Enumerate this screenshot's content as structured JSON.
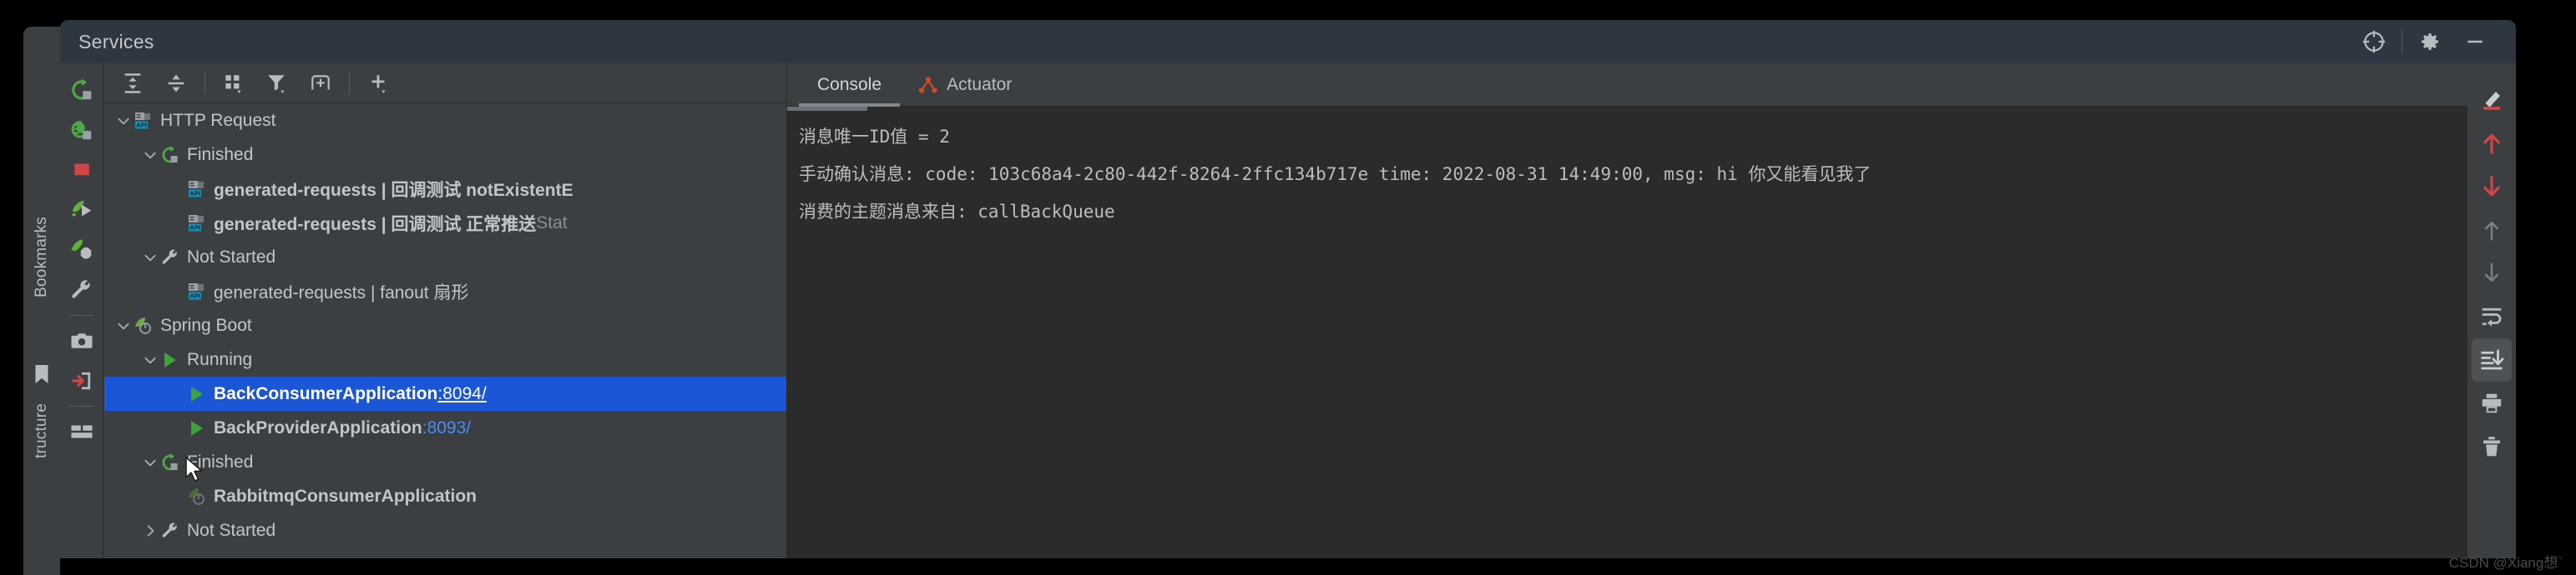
{
  "window": {
    "title": "Services"
  },
  "titlebar_actions": [
    {
      "name": "locate-icon",
      "label": "Select Opened File"
    },
    {
      "name": "gear-icon",
      "label": "Settings"
    },
    {
      "name": "minimize-icon",
      "label": "Hide"
    }
  ],
  "left_strip": {
    "bookmarks_label": "Bookmarks",
    "structure_label": "tructure"
  },
  "rail_actions": [
    {
      "name": "rerun-icon",
      "label": "Rerun"
    },
    {
      "name": "rerun-debug-icon",
      "label": "Rerun Debug"
    },
    {
      "name": "stop-icon",
      "label": "Stop"
    },
    {
      "name": "run-icon",
      "label": "Run"
    },
    {
      "name": "debug-icon",
      "label": "Debug"
    },
    {
      "name": "wrench-icon",
      "label": "Edit Configuration"
    },
    {
      "name": "camera-icon",
      "label": "Capture Memory Snapshot"
    },
    {
      "name": "attach-icon",
      "label": "Attach Profiler"
    },
    {
      "name": "layout-icon",
      "label": "Layout Settings"
    }
  ],
  "tree_toolbar": [
    {
      "name": "expand-all-icon",
      "label": "Expand All"
    },
    {
      "name": "collapse-all-icon",
      "label": "Collapse All"
    },
    {
      "name": "group-by-icon",
      "label": "Group By"
    },
    {
      "name": "filter-icon",
      "label": "Filter"
    },
    {
      "name": "add-tab-icon",
      "label": "Show in New Tab"
    },
    {
      "name": "add-service-icon",
      "label": "Add Service"
    }
  ],
  "tree": [
    {
      "id": "http-request",
      "depth": 0,
      "twist": "down",
      "icon": "api-node-icon",
      "label": "HTTP Request",
      "style": "normal"
    },
    {
      "id": "http-finished",
      "depth": 1,
      "twist": "down",
      "icon": "rerun-green-icon",
      "label": "Finished",
      "style": "normal"
    },
    {
      "id": "req-not-exist",
      "depth": 2,
      "twist": "none",
      "icon": "api-node-icon",
      "label": "generated-requests  |  回调测试 notExistentE",
      "style": "bold"
    },
    {
      "id": "req-normal",
      "depth": 2,
      "twist": "none",
      "icon": "api-node-icon",
      "label": "generated-requests  |  回调测试 正常推送 ",
      "suffix": "Stat",
      "style": "bold"
    },
    {
      "id": "http-notstart",
      "depth": 1,
      "twist": "down",
      "icon": "wrench-icon",
      "label": "Not Started",
      "style": "normal"
    },
    {
      "id": "req-fanout",
      "depth": 2,
      "twist": "none",
      "icon": "api-node-icon",
      "label": "generated-requests  |  fanout 扇形",
      "style": "normal"
    },
    {
      "id": "spring-boot",
      "depth": 0,
      "twist": "down",
      "icon": "spring-leaf-icon",
      "label": "Spring Boot",
      "style": "normal"
    },
    {
      "id": "sb-running",
      "depth": 1,
      "twist": "down",
      "icon": "run-play-icon",
      "label": "Running",
      "style": "normal"
    },
    {
      "id": "back-consumer",
      "depth": 2,
      "twist": "none",
      "icon": "run-play-icon",
      "label": "BackConsumerApplication ",
      "port": ":8094/",
      "style": "bold",
      "selected": true
    },
    {
      "id": "back-provider",
      "depth": 2,
      "twist": "none",
      "icon": "run-play-icon",
      "label": "BackProviderApplication ",
      "port": ":8093/",
      "style": "bold"
    },
    {
      "id": "sb-finished",
      "depth": 1,
      "twist": "down",
      "icon": "rerun-green-icon",
      "label": "Finished",
      "style": "normal",
      "cursor": true
    },
    {
      "id": "rabbitmq-app",
      "depth": 2,
      "twist": "none",
      "icon": "spring-leaf-dim-icon",
      "label": "RabbitmqConsumerApplication",
      "style": "bold"
    },
    {
      "id": "sb-notstarted",
      "depth": 1,
      "twist": "right",
      "icon": "wrench-icon",
      "label": "Not Started",
      "style": "normal"
    }
  ],
  "tabs": [
    {
      "id": "console",
      "label": "Console",
      "icon": null,
      "active": true
    },
    {
      "id": "actuator",
      "label": "Actuator",
      "icon": "actuator-icon",
      "active": false
    }
  ],
  "console_lines": [
    "消息唯一ID值 = 2",
    "手动确认消息: code: 103c68a4-2c80-442f-8264-2ffc134b717e time: 2022-08-31 14:49:00, msg: hi 你又能看见我了",
    "消费的主题消息来自: callBackQueue"
  ],
  "right_rail_actions": [
    {
      "name": "soft-wrap-highlight-icon",
      "label": "Highlight",
      "toggled": false
    },
    {
      "name": "up-arrow-red-icon",
      "label": "Previous Occurrence",
      "toggled": false
    },
    {
      "name": "down-arrow-red-icon",
      "label": "Next Occurrence",
      "toggled": false
    },
    {
      "name": "up-arrow-grey-icon",
      "label": "Up the Stack Trace",
      "toggled": false
    },
    {
      "name": "down-arrow-grey-icon",
      "label": "Down the Stack Trace",
      "toggled": false
    },
    {
      "name": "soft-wrap-icon",
      "label": "Use Soft Wraps",
      "toggled": false
    },
    {
      "name": "scroll-to-end-icon",
      "label": "Scroll to the End",
      "toggled": true
    },
    {
      "name": "print-icon",
      "label": "Print",
      "toggled": false
    },
    {
      "name": "trash-icon",
      "label": "Clear All",
      "toggled": false
    }
  ],
  "watermark": "CSDN @Xiang想`",
  "colors": {
    "selection": "#1a56d6",
    "port_link": "#4a8df8",
    "green": "#4fa845",
    "red": "#d14545",
    "title_bg": "#2e3641",
    "panel_bg": "#3c3f41",
    "console_bg": "#2b2b2b"
  }
}
